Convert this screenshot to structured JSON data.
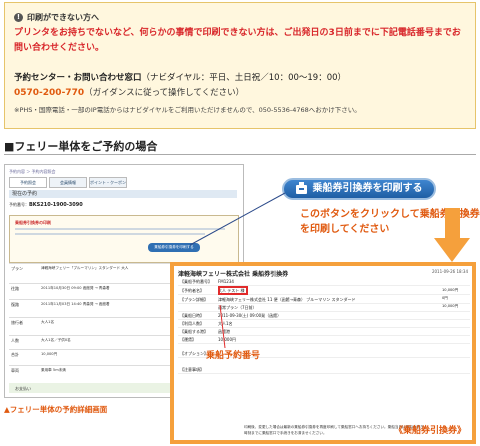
{
  "notice": {
    "title": "印刷ができない方へ",
    "red_text": "プリンタをお持ちでないなど、何らかの事情で印刷できない方は、ご出発日の3日前までに下記電話番号までお問い合わせください。",
    "center_label": "予約センター・お問い合わせ窓口",
    "center_hours": "（ナビダイヤル：平日、土日祝／10：00～19：00）",
    "phone": "0570-200-770",
    "phone_note": "（ガイダンスに従って操作してください）",
    "footnote": "※PHS・国際電話・一部のIP電話からはナビダイヤルをご利用いただけませんので、050-5536-4768へおかけ下さい。"
  },
  "section": {
    "title": "■フェリー単体をご予約の場合"
  },
  "thumb": {
    "crumb": "予約内容 ＞ 予約内容照会",
    "tabs": [
      "予約照会",
      "会員情報",
      "ポイント・クーポン"
    ],
    "title": "現在の予約",
    "resno_label": "予約番号",
    "resno_value": "BKS210-1900-3090",
    "box_title": "乗船券引換券の印刷",
    "print_button": "乗船券引換券を印刷する",
    "rows": [
      {
        "label": "プラン",
        "value": "津軽海峡フェリー「ブルーマリン」スタンダード 大人"
      },
      {
        "label": "往路",
        "value": "2011年10月30日 09:00 函館発 → 青森着"
      },
      {
        "label": "復路",
        "value": "2011年11月03日 14:40 青森発 → 函館着"
      },
      {
        "label": "旅行者",
        "value": "大人1名"
      },
      {
        "label": "人数",
        "value": "大人1名／子供0名"
      },
      {
        "label": "合計",
        "value": "10,000円"
      },
      {
        "label": "車両",
        "value": "乗用車 5m未満"
      }
    ],
    "green_label": "お支払い"
  },
  "caption": "▲フェリー単体の予約詳細画面",
  "callout": {
    "button": "乗船券引換券を印刷する",
    "text": "このボタンをクリックして乗船券引換券を印刷してください"
  },
  "ticket": {
    "title": "津軽海峡フェリー株式会社 乗船券引換券",
    "date": "2011-09-26 18:34",
    "rows": [
      {
        "label": "【乗船予約番号】",
        "value": "FM1234"
      },
      {
        "label": "【予約者名】",
        "value": "大人 テスト 様"
      },
      {
        "label": "【プラン詳細】",
        "value": "津軽海峡フェリー株式会社 11 便（函館→青森） ブルーマリン スタンダード"
      },
      {
        "label": "",
        "value": "通常プラン（7日前）"
      },
      {
        "label": "【乗船日時】",
        "value": "2011-09-30(土) 09:00発（函館）"
      },
      {
        "label": "【利用人数】",
        "value": "大人1名"
      },
      {
        "label": "【乗船する港】",
        "value": "函館港"
      },
      {
        "label": "【運賃】",
        "value": "10,000円"
      },
      {
        "label": "【オプション】",
        "value": ""
      },
      {
        "label": "【注意事項】",
        "value": ""
      }
    ],
    "right_values": [
      "10,000円",
      "0円",
      "10,000円"
    ],
    "note": "印刷後、変更した場合は最新の乗船券引換券を再度印刷して乗船窓口へお持ちください。乗船当日は乗船手続き時刻までに乗船窓口で手続きをお済ませください。",
    "caption": "《乗船券引換券》",
    "highlight_label": "乗船予約番号"
  },
  "colors": {
    "accent": "#e05a10",
    "red": "#d8262a",
    "button": "#2b6db8"
  }
}
